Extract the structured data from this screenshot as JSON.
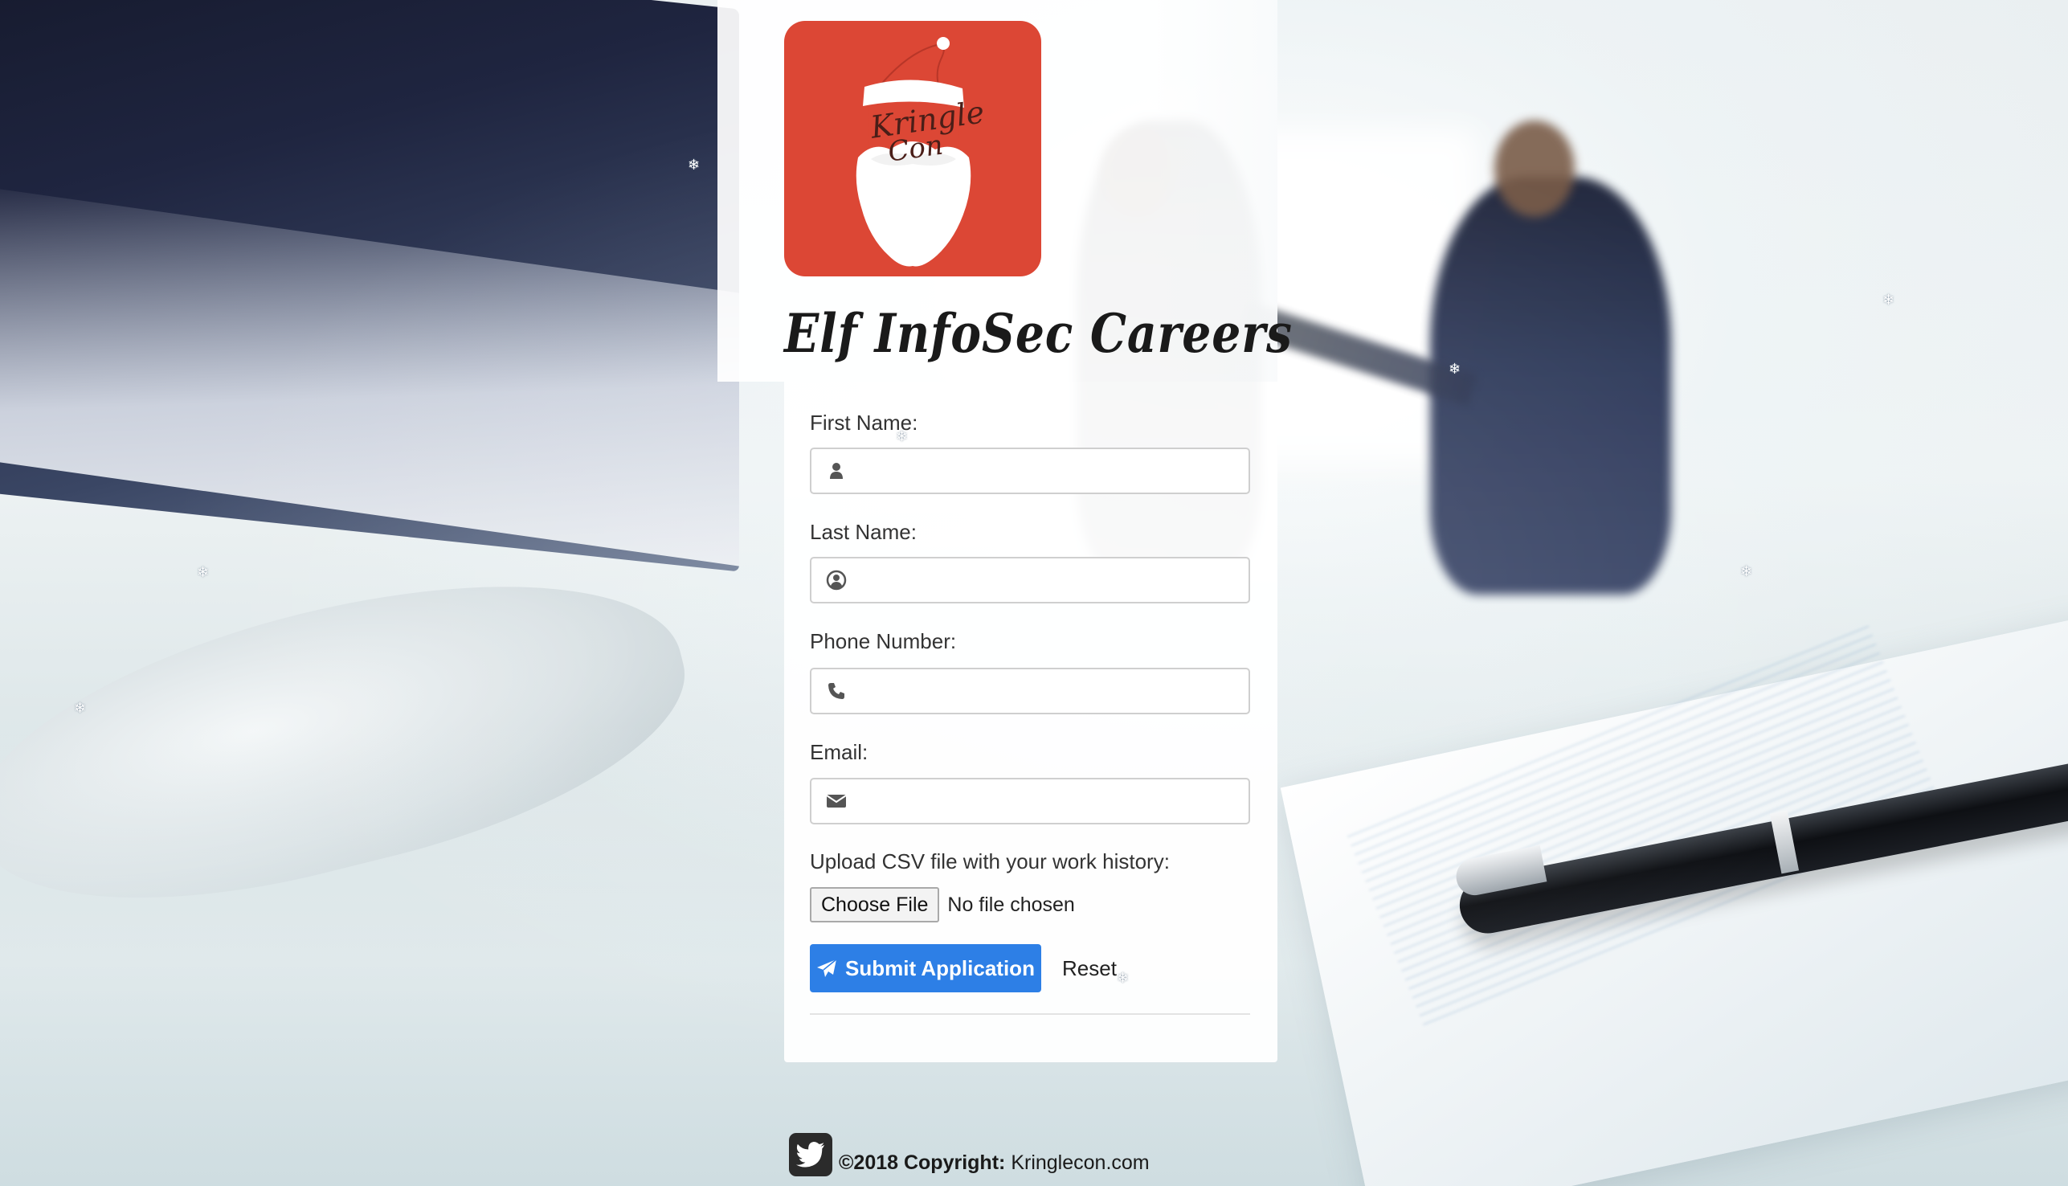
{
  "page": {
    "title": "Elf InfoSec Careers"
  },
  "logo": {
    "text_line1": "Kringle",
    "text_line2": "Con",
    "bg_color": "#dc4735"
  },
  "form": {
    "fields": [
      {
        "label": "First Name:",
        "icon": "user-icon",
        "value": "",
        "placeholder": ""
      },
      {
        "label": "Last Name:",
        "icon": "user-circle-icon",
        "value": "",
        "placeholder": ""
      },
      {
        "label": "Phone Number:",
        "icon": "phone-icon",
        "value": "",
        "placeholder": ""
      },
      {
        "label": "Email:",
        "icon": "envelope-icon",
        "value": "",
        "placeholder": ""
      }
    ],
    "upload": {
      "label": "Upload CSV file with your work history:",
      "button_label": "Choose File",
      "status": "No file chosen"
    },
    "submit_label": "Submit Application",
    "submit_icon": "paper-plane-icon",
    "reset_label": "Reset",
    "accent_color": "#2d7fe6"
  },
  "footer": {
    "social_icon": "twitter-icon",
    "copyright_prefix": "©2018 Copyright:",
    "site": "Kringlecon.com"
  },
  "decor": {
    "snowflake_glyph": "❄"
  }
}
